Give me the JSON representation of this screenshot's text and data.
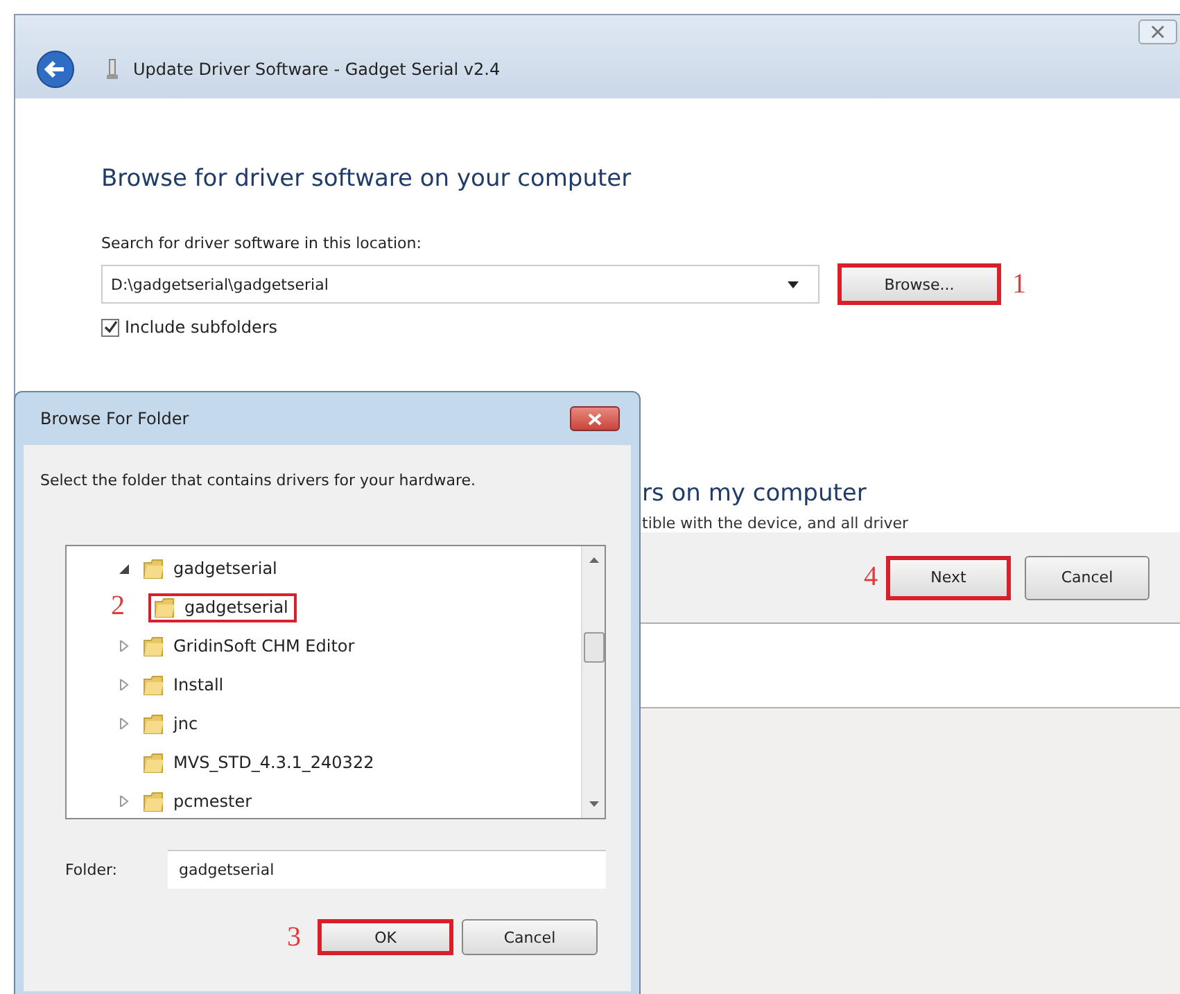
{
  "window": {
    "title": "Update Driver Software - Gadget Serial v2.4"
  },
  "heading": "Browse for driver software on your computer",
  "location": {
    "label": "Search for driver software in this location:",
    "value": "D:\\gadgetserial\\gadgetserial",
    "browse_button": {
      "label": "Browse...",
      "highlighted": true
    },
    "callout": "1"
  },
  "include_subfolders": {
    "label": "Include subfolders",
    "checked": true
  },
  "covered_option": {
    "title": "rs on my computer",
    "description": "tible with the device, and all driver"
  },
  "footer": {
    "buttons": [
      {
        "label": "Next",
        "highlighted": true,
        "callout": "4"
      },
      {
        "label": "Cancel",
        "highlighted": false
      }
    ]
  },
  "dialog": {
    "title": "Browse For Folder",
    "instruction": "Select the folder that contains drivers for your hardware.",
    "tree": [
      {
        "label": "gadgetserial",
        "kind": "expanded",
        "highlighted": false,
        "children": [
          {
            "label": "gadgetserial",
            "kind": "leaf",
            "highlighted": true,
            "callout": "2"
          }
        ]
      },
      {
        "label": "GridinSoft CHM Editor",
        "kind": "collapsed",
        "highlighted": false
      },
      {
        "label": "Install",
        "kind": "collapsed",
        "highlighted": false
      },
      {
        "label": "jnc",
        "kind": "collapsed",
        "highlighted": false
      },
      {
        "label": "MVS_STD_4.3.1_240322",
        "kind": "leaf",
        "highlighted": false
      },
      {
        "label": "pcmester",
        "kind": "collapsed",
        "highlighted": false
      }
    ],
    "folder_label": "Folder:",
    "folder_value": "gadgetserial",
    "buttons": [
      {
        "label": "OK",
        "highlighted": true,
        "callout": "3"
      },
      {
        "label": "Cancel",
        "highlighted": false
      }
    ]
  }
}
